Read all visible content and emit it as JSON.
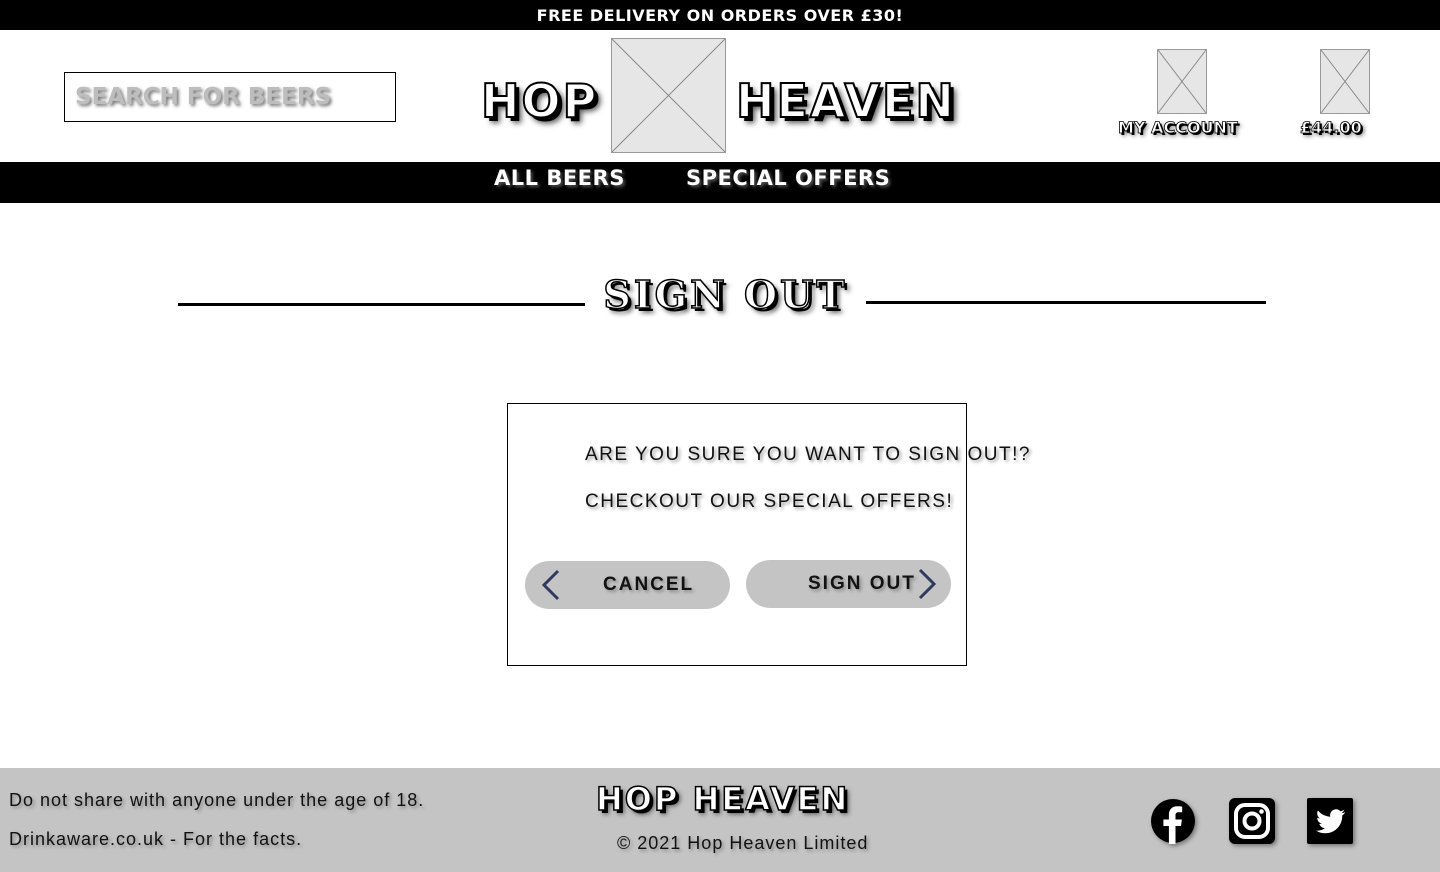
{
  "banner": {
    "text": "FREE DELIVERY ON ORDERS OVER £30!"
  },
  "header": {
    "search_placeholder": "SEARCH FOR BEERS",
    "logo_left": "HOP",
    "logo_right": "HEAVEN",
    "account_label": "MY ACCOUNT",
    "cart_total": "£44.00"
  },
  "nav": {
    "items": [
      "ALL BEERS",
      "SPECIAL OFFERS"
    ]
  },
  "page": {
    "title": "SIGN OUT"
  },
  "dialog": {
    "message": "ARE YOU SURE YOU WANT TO SIGN OUT!?",
    "submessage": "CHECKOUT OUR SPECIAL OFFERS!",
    "cancel_label": "CANCEL",
    "signout_label": "SIGN OUT"
  },
  "footer": {
    "age_notice": "Do not share with anyone under the age of 18.",
    "drinkaware": "Drinkaware.co.uk - For the facts.",
    "logo": "HOP HEAVEN",
    "copyright": "© 2021 Hop Heaven Limited"
  },
  "colors": {
    "banner_bg": "#000000",
    "button_bg": "#c4c4c4",
    "chevron": "#2f3a5e",
    "footer_bg": "#c4c4c4"
  },
  "icons": {
    "social": [
      "facebook-icon",
      "instagram-icon",
      "twitter-icon"
    ],
    "chevrons": [
      "chevron-left-icon",
      "chevron-right-icon"
    ]
  }
}
